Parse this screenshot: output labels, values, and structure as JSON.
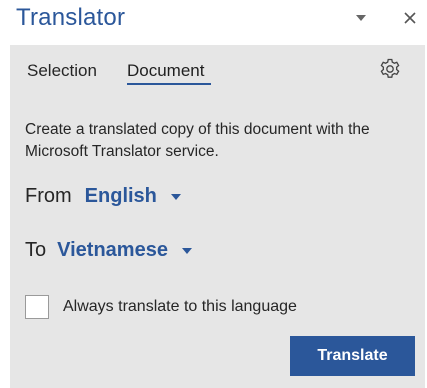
{
  "pane": {
    "title": "Translator",
    "menu_icon": "caret-down-icon",
    "close_icon": "close-icon"
  },
  "tabs": [
    {
      "label": "Selection",
      "active": false
    },
    {
      "label": "Document",
      "active": true
    }
  ],
  "settings_icon": "gear-icon",
  "description": "Create a translated copy of this document with the Microsoft Translator service.",
  "from": {
    "label": "From",
    "value": "English"
  },
  "to": {
    "label": "To",
    "value": "Vietnamese"
  },
  "always_translate": {
    "label": "Always translate to this language",
    "checked": false
  },
  "translate_button": {
    "label": "Translate"
  },
  "colors": {
    "accent": "#2b579a",
    "panel_bg": "#e6e6e6",
    "text": "#262626"
  }
}
